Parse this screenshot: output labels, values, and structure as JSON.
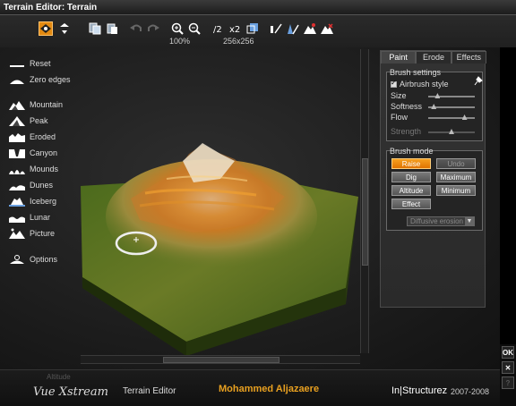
{
  "window": {
    "title": "Terrain Editor: Terrain"
  },
  "toolbar": {
    "zoom_label": "100%",
    "resolution_label": "256x256",
    "buttons": [
      "paint-mode-icon",
      "selector-dropdown-icon",
      "copy-icon",
      "paste-icon",
      "undo-icon",
      "redo-icon",
      "zoom-in-icon",
      "zoom-out-icon",
      "halve-resolution-icon",
      "double-resolution-icon",
      "resize-icon",
      "invert-icon",
      "slope-icon",
      "terrain-icon-1",
      "terrain-icon-2"
    ]
  },
  "left_nav": {
    "items": [
      {
        "label": "Reset",
        "icon": "reset-icon"
      },
      {
        "label": "Zero edges",
        "icon": "zero-edges-icon"
      },
      {
        "label": "Mountain",
        "icon": "mountain-icon"
      },
      {
        "label": "Peak",
        "icon": "peak-icon"
      },
      {
        "label": "Eroded",
        "icon": "eroded-icon"
      },
      {
        "label": "Canyon",
        "icon": "canyon-icon"
      },
      {
        "label": "Mounds",
        "icon": "mounds-icon"
      },
      {
        "label": "Dunes",
        "icon": "dunes-icon"
      },
      {
        "label": "Iceberg",
        "icon": "iceberg-icon"
      },
      {
        "label": "Lunar",
        "icon": "lunar-icon"
      },
      {
        "label": "Picture",
        "icon": "picture-icon"
      },
      {
        "label": "Options",
        "icon": "options-icon"
      }
    ]
  },
  "panel": {
    "tabs": [
      {
        "label": "Paint",
        "active": true
      },
      {
        "label": "Erode",
        "active": false
      },
      {
        "label": "Effects",
        "active": false
      }
    ],
    "brush_settings": {
      "title": "Brush settings",
      "airbrush_label": "Airbrush style",
      "airbrush_checked": true,
      "size_label": "Size",
      "size_value": 0.2,
      "softness_label": "Softness",
      "softness_value": 0.12,
      "flow_label": "Flow",
      "flow_value": 0.78,
      "strength_label": "Strength",
      "strength_value": 0.5
    },
    "brush_mode": {
      "title": "Brush mode",
      "raise": "Raise",
      "undo": "Undo",
      "dig": "Dig",
      "maximum": "Maximum",
      "altitude": "Altitude",
      "minimum": "Minimum",
      "effect": "Effect",
      "effect_select": "Diffusive erosion"
    }
  },
  "footer": {
    "product": "Vue Xstream",
    "editor": "Terrain Editor",
    "author": "Mohammed Aljazaere",
    "brand": "In|Structurez",
    "year": "2007-2008",
    "ghost_label": "Altitude"
  },
  "side_buttons": {
    "ok": "OK",
    "close": "✕",
    "help": "?"
  },
  "colors": {
    "accent": "#e38a12",
    "author": "#e8a020",
    "background": "#1a1a1a"
  }
}
